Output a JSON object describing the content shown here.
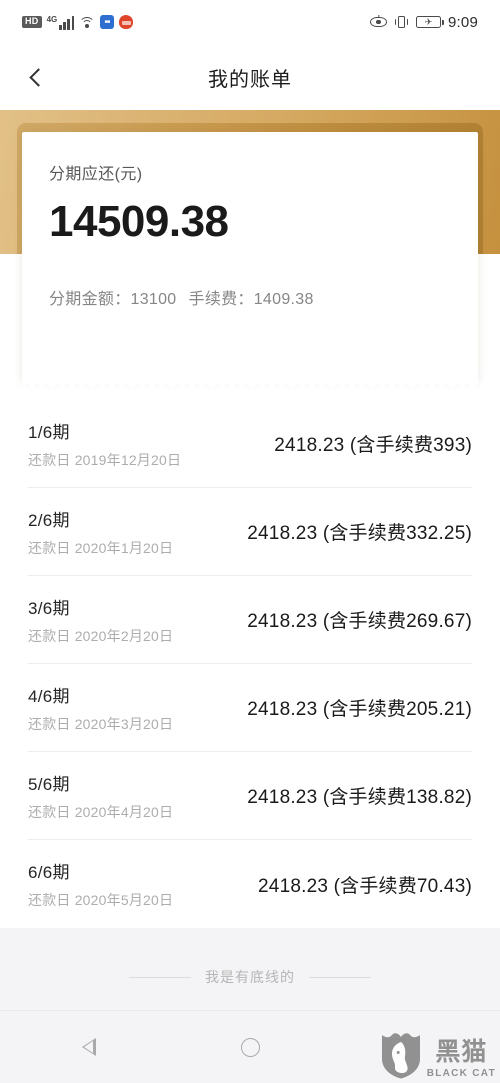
{
  "statusbar": {
    "hd_label": "HD",
    "network_label": "4G",
    "icons": [
      "hd-badge",
      "signal-4g-icon",
      "wifi-icon",
      "app-blue-icon",
      "app-red-icon",
      "eye-care-icon",
      "vibrate-icon",
      "battery-charging-icon"
    ],
    "time": "9:09",
    "battery_glyph": "✈"
  },
  "header": {
    "title": "我的账单",
    "back_icon": "chevron-left-icon"
  },
  "summary_card": {
    "label": "分期应还(元)",
    "amount": "14509.38",
    "principal_label": "分期金额：",
    "principal_value": "13100",
    "fee_label": "手续费：",
    "fee_value": "1409.38"
  },
  "installments": [
    {
      "term": "1/6期",
      "date": "还款日 2019年12月20日",
      "amount": "2418.23 (含手续费393)"
    },
    {
      "term": "2/6期",
      "date": "还款日 2020年1月20日",
      "amount": "2418.23 (含手续费332.25)"
    },
    {
      "term": "3/6期",
      "date": "还款日 2020年2月20日",
      "amount": "2418.23 (含手续费269.67)"
    },
    {
      "term": "4/6期",
      "date": "还款日 2020年3月20日",
      "amount": "2418.23 (含手续费205.21)"
    },
    {
      "term": "5/6期",
      "date": "还款日 2020年4月20日",
      "amount": "2418.23 (含手续费138.82)"
    },
    {
      "term": "6/6期",
      "date": "还款日 2020年5月20日",
      "amount": "2418.23 (含手续费70.43)"
    }
  ],
  "footer": {
    "end_text": "我是有底线的"
  },
  "android_nav": {
    "back_icon": "nav-back-triangle-icon",
    "home_icon": "nav-home-circle-icon",
    "recents_icon": "nav-recents-square-icon"
  },
  "watermark": {
    "cn": "黑猫",
    "en": "BLACK CAT",
    "logo_icon": "black-cat-shield-icon"
  },
  "colors": {
    "gold_light": "#e2c187",
    "gold_dark": "#c5913f",
    "page_bg": "#f4f4f6",
    "text_primary": "#1a1a1a",
    "text_muted": "#adadad"
  }
}
